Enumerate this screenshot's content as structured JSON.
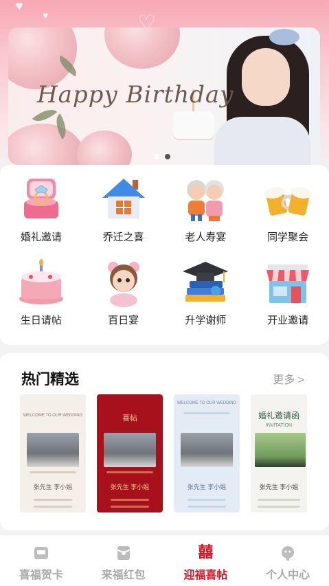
{
  "banner": {
    "title": "Happy Birthday",
    "carousel": {
      "count": 2,
      "active_index": 1
    }
  },
  "categories": [
    {
      "label": "婚礼邀请",
      "icon": "ring-box-icon"
    },
    {
      "label": "乔迁之喜",
      "icon": "house-icon"
    },
    {
      "label": "老人寿宴",
      "icon": "elderly-couple-icon"
    },
    {
      "label": "同学聚会",
      "icon": "beer-mugs-icon"
    },
    {
      "label": "生日请帖",
      "icon": "birthday-cake-icon"
    },
    {
      "label": "百日宴",
      "icon": "baby-icon"
    },
    {
      "label": "升学谢师",
      "icon": "graduation-cap-icon"
    },
    {
      "label": "开业邀请",
      "icon": "storefront-icon"
    }
  ],
  "hot": {
    "title": "热门精选",
    "more": "更多 >",
    "templates": [
      {
        "header": "WELCOME TO OUR WEDDING",
        "names": "张先生  李小姐",
        "theme": "cream"
      },
      {
        "header": "喜帖",
        "names": "张先生  李小姐",
        "theme": "red"
      },
      {
        "header": "WELCOME TO OUR WEDDING",
        "names": "张先生  李小姐",
        "theme": "blue"
      },
      {
        "header": "婚礼邀请函",
        "subheader": "INVITATION",
        "names": "张先生  李小姐",
        "theme": "green"
      }
    ]
  },
  "tabs": [
    {
      "label": "喜福贺卡",
      "icon": "card-icon",
      "active": false
    },
    {
      "label": "来福红包",
      "icon": "red-envelope-icon",
      "active": false
    },
    {
      "label": "迎福喜帖",
      "icon": "double-happiness-icon",
      "active": true,
      "glyph": "囍"
    },
    {
      "label": "个人中心",
      "icon": "profile-icon",
      "active": false
    }
  ],
  "colors": {
    "accent": "#d8121f",
    "tab_inactive": "#a9a9a9"
  }
}
